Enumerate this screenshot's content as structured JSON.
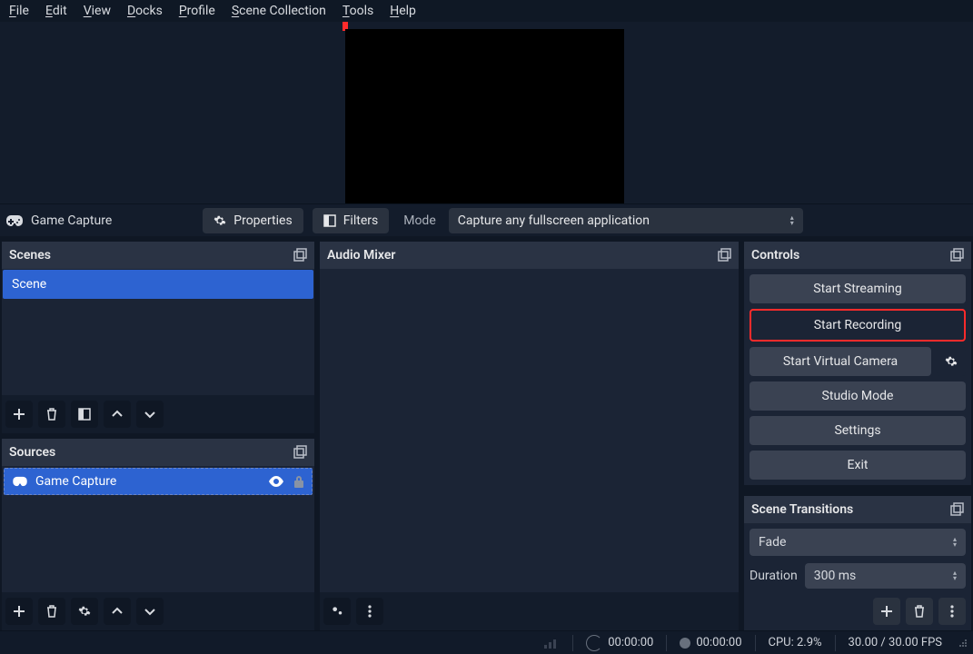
{
  "menubar": [
    "File",
    "Edit",
    "View",
    "Docks",
    "Profile",
    "Scene Collection",
    "Tools",
    "Help"
  ],
  "context": {
    "source_name": "Game Capture",
    "properties": "Properties",
    "filters": "Filters",
    "mode_label": "Mode",
    "mode_value": "Capture any fullscreen application"
  },
  "scenes": {
    "title": "Scenes",
    "items": [
      "Scene"
    ]
  },
  "sources": {
    "title": "Sources",
    "items": [
      {
        "name": "Game Capture",
        "visible": true,
        "locked": true
      }
    ]
  },
  "mixer": {
    "title": "Audio Mixer"
  },
  "controls": {
    "title": "Controls",
    "start_streaming": "Start Streaming",
    "start_recording": "Start Recording",
    "start_virtual_camera": "Start Virtual Camera",
    "studio_mode": "Studio Mode",
    "settings": "Settings",
    "exit": "Exit"
  },
  "transitions": {
    "title": "Scene Transitions",
    "current": "Fade",
    "duration_label": "Duration",
    "duration_value": "300 ms"
  },
  "status": {
    "live_time": "00:00:00",
    "rec_time": "00:00:00",
    "cpu": "CPU: 2.9%",
    "fps": "30.00 / 30.00 FPS"
  }
}
